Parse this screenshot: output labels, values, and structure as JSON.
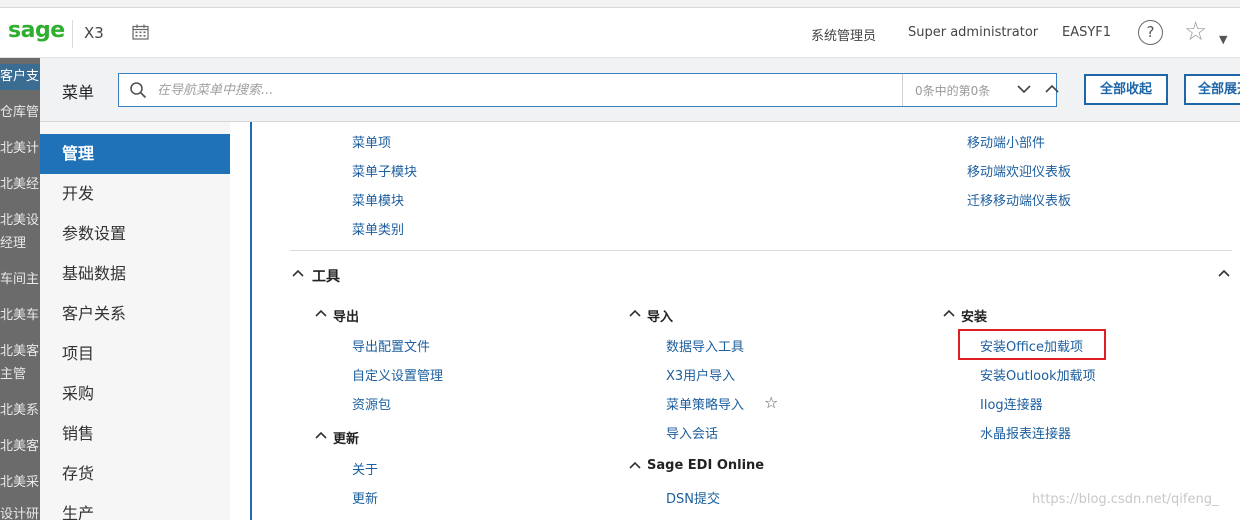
{
  "header": {
    "logo": "sage",
    "app_name": "X3",
    "user_role": "系统管理员",
    "user_name": "Super administrator",
    "folder": "EASYF1",
    "help": "?",
    "star": "☆",
    "caret": "▼"
  },
  "background_list": [
    "客户支",
    "仓库管",
    "北美计",
    "北美经",
    "北美设",
    "经理",
    "车间主",
    "北美车",
    "北美客",
    "主管",
    "北美系",
    "北美客",
    "北美采",
    "设计研"
  ],
  "search": {
    "label": "菜单",
    "placeholder": "在导航菜单中搜索...",
    "count": "0条中的第0条",
    "collapse_all": "全部收起",
    "expand_all": "全部展开"
  },
  "leftnav": {
    "items": [
      "管理",
      "开发",
      "参数设置",
      "基础数据",
      "客户关系",
      "项目",
      "采购",
      "销售",
      "存货",
      "生产"
    ]
  },
  "content": {
    "top_col1": [
      "菜单项",
      "菜单子模块",
      "菜单模块",
      "菜单类别"
    ],
    "top_col3": [
      "移动端小部件",
      "移动端欢迎仪表板",
      "迁移移动端仪表板"
    ],
    "tools_title": "工具",
    "export": {
      "title": "导出",
      "items": [
        "导出配置文件",
        "自定义设置管理",
        "资源包"
      ]
    },
    "update": {
      "title": "更新",
      "items": [
        "关于",
        "更新"
      ]
    },
    "import": {
      "title": "导入",
      "items": [
        "数据导入工具",
        "X3用户导入",
        "菜单策略导入",
        "导入会话"
      ]
    },
    "edi": {
      "title": "Sage EDI Online",
      "items": [
        "DSN提交"
      ]
    },
    "install": {
      "title": "安装",
      "items": [
        "安装Office加载项",
        "安装Outlook加载项",
        "Ilog连接器",
        "水晶报表连接器"
      ]
    },
    "watermark": "https://blog.csdn.net/qifeng_"
  },
  "colors": {
    "brand_green": "#2fae2f",
    "accent_blue": "#1f72b8",
    "link_blue": "#1d5e9e",
    "highlight_red": "#e02020"
  }
}
